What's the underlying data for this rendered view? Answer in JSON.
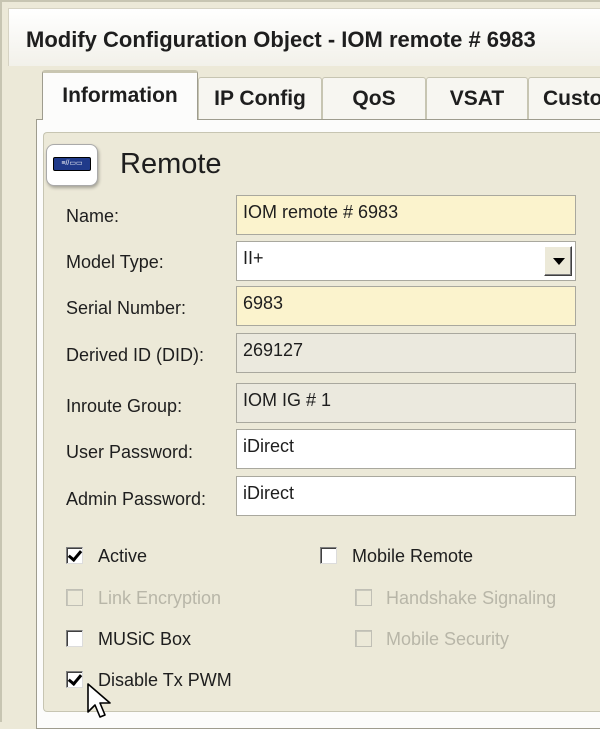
{
  "window": {
    "title": "Modify Configuration Object - IOM remote # 6983"
  },
  "tabs": [
    {
      "label": "Information",
      "active": true
    },
    {
      "label": "IP Config",
      "active": false
    },
    {
      "label": "QoS",
      "active": false
    },
    {
      "label": "VSAT",
      "active": false
    },
    {
      "label": "Custo",
      "active": false
    }
  ],
  "section": {
    "title": "Remote",
    "icon": "remote-modem-icon",
    "icon_text": "≡//▭▭"
  },
  "fields": {
    "name": {
      "label": "Name:",
      "value": "IOM remote # 6983"
    },
    "model_type": {
      "label": "Model Type:",
      "value": "II+"
    },
    "serial_number": {
      "label": "Serial Number:",
      "value": "6983"
    },
    "derived_id": {
      "label": "Derived ID (DID):",
      "value": "269127"
    },
    "inroute_group": {
      "label": "Inroute Group:",
      "value": "IOM IG # 1"
    },
    "user_password": {
      "label": "User Password:",
      "value": "iDirect"
    },
    "admin_password": {
      "label": "Admin Password:",
      "value": "iDirect"
    }
  },
  "checkboxes": {
    "active": {
      "label": "Active",
      "checked": true,
      "enabled": true
    },
    "mobile_remote": {
      "label": "Mobile Remote",
      "checked": false,
      "enabled": true
    },
    "link_encryption": {
      "label": "Link Encryption",
      "checked": false,
      "enabled": false
    },
    "handshake_signaling": {
      "label": "Handshake Signaling",
      "checked": false,
      "enabled": false
    },
    "music_box": {
      "label": "MUSiC Box",
      "checked": false,
      "enabled": true
    },
    "mobile_security": {
      "label": "Mobile Security",
      "checked": false,
      "enabled": false
    },
    "disable_tx_pwm": {
      "label": "Disable Tx PWM",
      "checked": true,
      "enabled": true
    }
  },
  "colors": {
    "required_field_bg": "#fbf3cd",
    "window_bg": "#ece9d8",
    "disabled_text": "#b8b6a8"
  }
}
